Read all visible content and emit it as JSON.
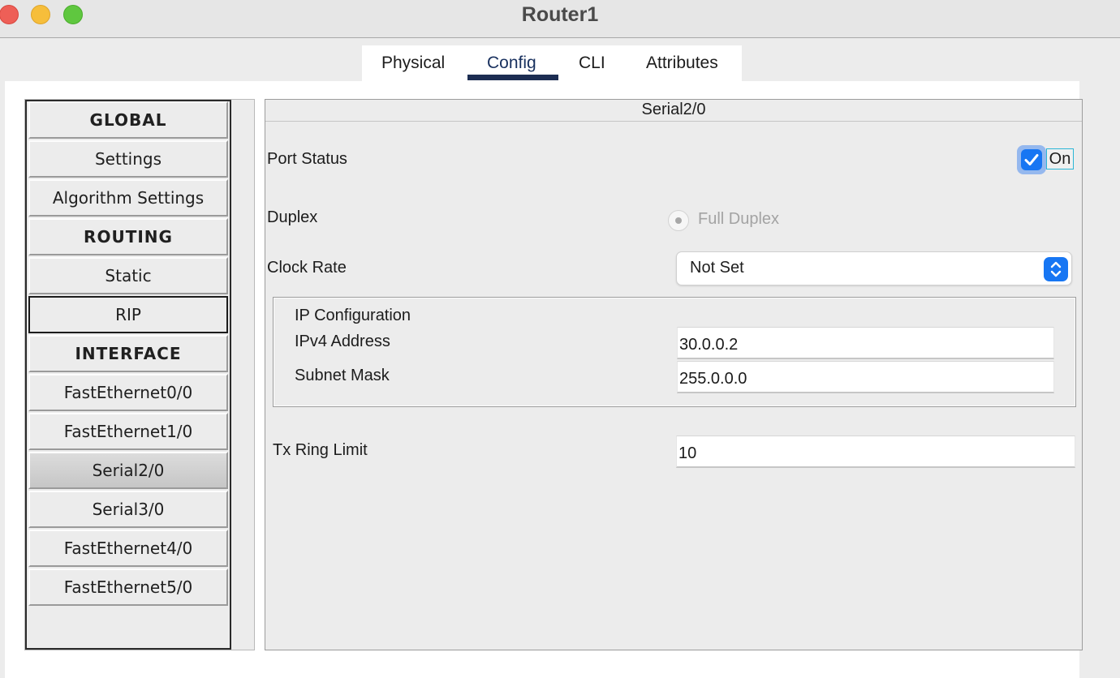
{
  "window": {
    "title": "Router1"
  },
  "tabs": [
    {
      "label": "Physical"
    },
    {
      "label": "Config"
    },
    {
      "label": "CLI"
    },
    {
      "label": "Attributes"
    }
  ],
  "active_tab": "Config",
  "sidebar": {
    "items": [
      {
        "label": "GLOBAL",
        "type": "header"
      },
      {
        "label": "Settings"
      },
      {
        "label": "Algorithm Settings"
      },
      {
        "label": "ROUTING",
        "type": "header"
      },
      {
        "label": "Static"
      },
      {
        "label": "RIP"
      },
      {
        "label": "INTERFACE",
        "type": "header"
      },
      {
        "label": "FastEthernet0/0"
      },
      {
        "label": "FastEthernet1/0"
      },
      {
        "label": "Serial2/0"
      },
      {
        "label": "Serial3/0"
      },
      {
        "label": "FastEthernet4/0"
      },
      {
        "label": "FastEthernet5/0"
      }
    ],
    "focused": "RIP",
    "selected": "Serial2/0"
  },
  "panel": {
    "title": "Serial2/0",
    "port_status": {
      "label": "Port Status",
      "checked": true,
      "state_label": "On"
    },
    "duplex": {
      "label": "Duplex",
      "option": "Full Duplex",
      "disabled": true
    },
    "clock_rate": {
      "label": "Clock Rate",
      "value": "Not Set"
    },
    "ip_config": {
      "heading": "IP Configuration",
      "ipv4_label": "IPv4 Address",
      "ipv4_value": "30.0.0.2",
      "mask_label": "Subnet Mask",
      "mask_value": "255.0.0.0"
    },
    "tx_ring": {
      "label": "Tx Ring Limit",
      "value": "10"
    }
  },
  "colors": {
    "accent_blue": "#1776f3",
    "tab_underline": "#1c2d52",
    "traffic_red": "#ee5f57",
    "traffic_yellow": "#f6be3b",
    "traffic_green": "#5fc73f"
  },
  "icons": {
    "checkbox": "checkmark-icon",
    "select": "chevron-up-down-icon"
  }
}
